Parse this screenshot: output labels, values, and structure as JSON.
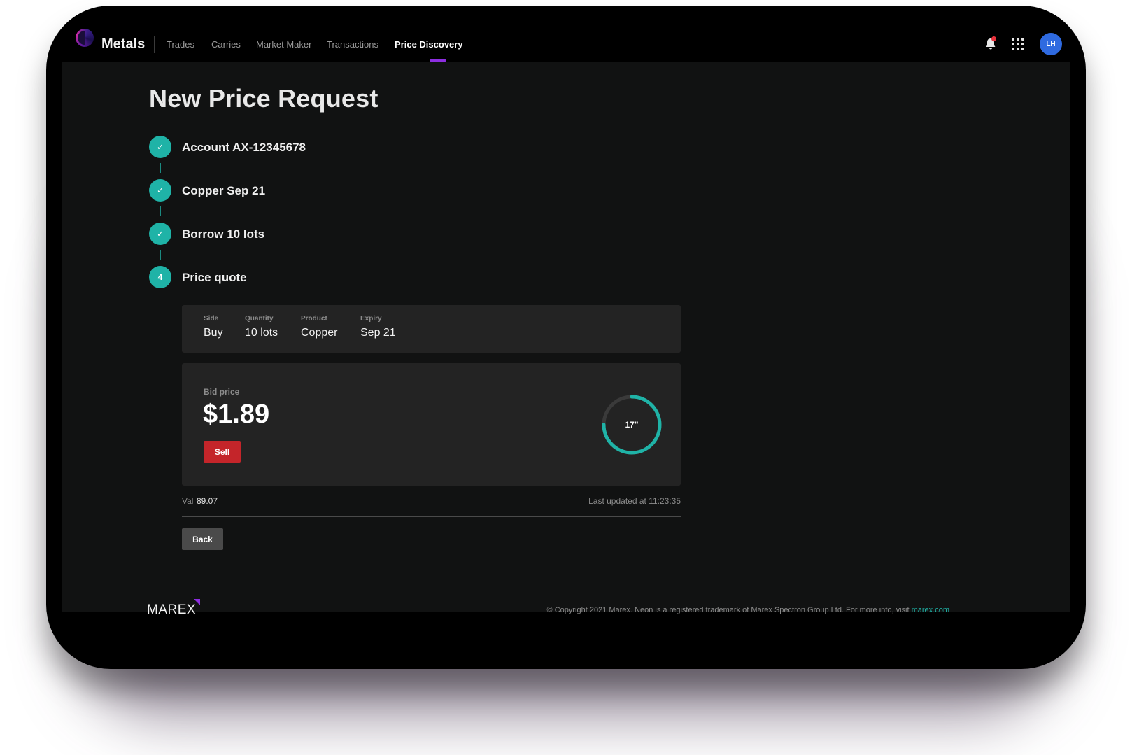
{
  "app": {
    "name": "Metals"
  },
  "nav": {
    "items": [
      {
        "label": "Trades"
      },
      {
        "label": "Carries"
      },
      {
        "label": "Market Maker"
      },
      {
        "label": "Transactions"
      },
      {
        "label": "Price Discovery",
        "active": true
      }
    ],
    "notifications_icon": "bell-icon",
    "apps_icon": "grid-icon",
    "avatar_initials": "LH"
  },
  "page": {
    "title": "New Price Request"
  },
  "steps": [
    {
      "marker": "✓",
      "label": "Account AX-12345678",
      "done": true
    },
    {
      "marker": "✓",
      "label": "Copper Sep 21",
      "done": true
    },
    {
      "marker": "✓",
      "label": "Borrow 10 lots",
      "done": true
    },
    {
      "marker": "4",
      "label": "Price quote",
      "done": false
    }
  ],
  "summary": {
    "side": {
      "label": "Side",
      "value": "Buy"
    },
    "quantity": {
      "label": "Quantity",
      "value": "10 lots"
    },
    "product": {
      "label": "Product",
      "value": "Copper"
    },
    "expiry": {
      "label": "Expiry",
      "value": "Sep 21"
    }
  },
  "quote": {
    "bid_label": "Bid price",
    "bid_price": "$1.89",
    "sell_label": "Sell",
    "timer_label": "17\"",
    "timer_fraction": 0.75
  },
  "footer_info": {
    "val_label": "Val",
    "val_value": "89.07",
    "last_updated": "Last updated at 11:23:35",
    "back_label": "Back"
  },
  "footer": {
    "logo": "MAREX",
    "copyright": "© Copyright 2021 Marex. Neon is a registered trademark of Marex Spectron Group Ltd. For more info, visit ",
    "link": "marex.com"
  },
  "colors": {
    "accent_teal": "#1fb3a7",
    "sell_red": "#c4252a",
    "nav_active": "#8d2ee0",
    "avatar_blue": "#2f6ae0"
  }
}
